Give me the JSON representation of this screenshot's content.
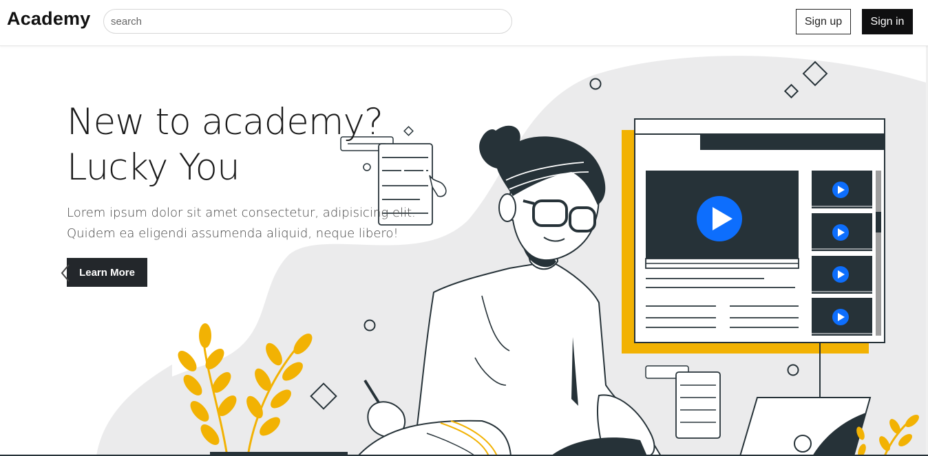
{
  "header": {
    "brand": "Academy",
    "search_placeholder": "search",
    "signup_label": "Sign up",
    "signin_label": "Sign in"
  },
  "hero": {
    "headline_line1": "New to academy?",
    "headline_line2": "Lucky You",
    "description": "Lorem ipsum dolor sit amet consectetur, adipisicing elit. Quidem ea eligendi assumenda aliquid, neque libero!",
    "cta_label": "Learn More"
  },
  "carousel": {
    "prev_icon": "chevron-left-icon",
    "next_icon": "chevron-right-icon"
  },
  "colors": {
    "accent_yellow": "#f2b203",
    "dark": "#263238",
    "play_blue": "#0d6efd",
    "blob_gray": "#ebebeb"
  }
}
